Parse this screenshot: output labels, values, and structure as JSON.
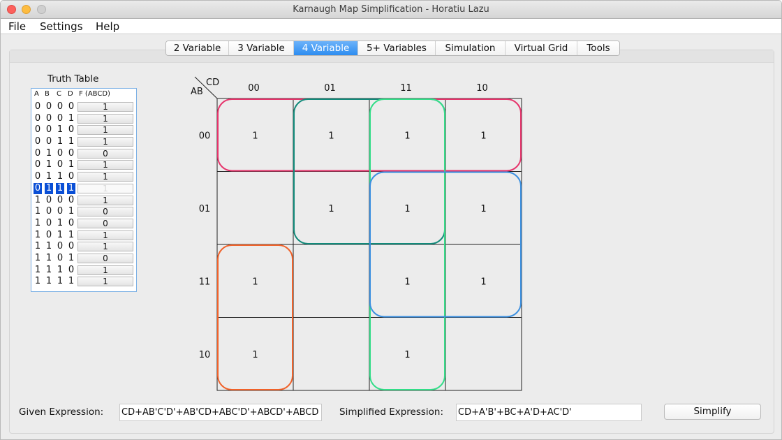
{
  "window": {
    "title": "Karnaugh Map Simplification - Horatiu Lazu"
  },
  "menu": [
    "File",
    "Settings",
    "Help"
  ],
  "tabs": [
    "2 Variable",
    "3 Variable",
    "4 Variable",
    "5+ Variables",
    "Simulation",
    "Virtual Grid",
    "Tools"
  ],
  "active_tab": "4 Variable",
  "truth_table": {
    "title": "Truth Table",
    "headers": [
      "A",
      "B",
      "C",
      "D",
      "F (ABCD)"
    ],
    "rows": [
      {
        "bits": [
          "0",
          "0",
          "0",
          "0"
        ],
        "f": "1"
      },
      {
        "bits": [
          "0",
          "0",
          "0",
          "1"
        ],
        "f": "1"
      },
      {
        "bits": [
          "0",
          "0",
          "1",
          "0"
        ],
        "f": "1"
      },
      {
        "bits": [
          "0",
          "0",
          "1",
          "1"
        ],
        "f": "1"
      },
      {
        "bits": [
          "0",
          "1",
          "0",
          "0"
        ],
        "f": "0"
      },
      {
        "bits": [
          "0",
          "1",
          "0",
          "1"
        ],
        "f": "1"
      },
      {
        "bits": [
          "0",
          "1",
          "1",
          "0"
        ],
        "f": "1"
      },
      {
        "bits": [
          "0",
          "1",
          "1",
          "1"
        ],
        "f": "1"
      },
      {
        "bits": [
          "1",
          "0",
          "0",
          "0"
        ],
        "f": "1"
      },
      {
        "bits": [
          "1",
          "0",
          "0",
          "1"
        ],
        "f": "0"
      },
      {
        "bits": [
          "1",
          "0",
          "1",
          "0"
        ],
        "f": "0"
      },
      {
        "bits": [
          "1",
          "0",
          "1",
          "1"
        ],
        "f": "1"
      },
      {
        "bits": [
          "1",
          "1",
          "0",
          "0"
        ],
        "f": "1"
      },
      {
        "bits": [
          "1",
          "1",
          "0",
          "1"
        ],
        "f": "0"
      },
      {
        "bits": [
          "1",
          "1",
          "1",
          "0"
        ],
        "f": "1"
      },
      {
        "bits": [
          "1",
          "1",
          "1",
          "1"
        ],
        "f": "1"
      }
    ],
    "selected_row": 7
  },
  "kmap": {
    "corner_top": "CD",
    "corner_left": "AB",
    "col_labels": [
      "00",
      "01",
      "11",
      "10"
    ],
    "row_labels": [
      "00",
      "01",
      "11",
      "10"
    ],
    "cells": [
      [
        "1",
        "1",
        "1",
        "1"
      ],
      [
        "",
        "1",
        "1",
        "1"
      ],
      [
        "1",
        "",
        "1",
        "1"
      ],
      [
        "1",
        "",
        "1",
        ""
      ]
    ],
    "groups": [
      {
        "color": "#e6336b",
        "rows": [
          0,
          0
        ],
        "cols": [
          0,
          3
        ]
      },
      {
        "color": "#128a7a",
        "rows": [
          0,
          1
        ],
        "cols": [
          1,
          2
        ]
      },
      {
        "color": "#33dd88",
        "rows": [
          0,
          3
        ],
        "cols": [
          2,
          2
        ]
      },
      {
        "color": "#3a8fe0",
        "rows": [
          1,
          2
        ],
        "cols": [
          2,
          3
        ]
      },
      {
        "color": "#f0622a",
        "rows": [
          2,
          3
        ],
        "cols": [
          0,
          0
        ]
      }
    ]
  },
  "bottom": {
    "given_label": "Given Expression:",
    "given_value": "CD+AB'C'D'+AB'CD+ABC'D'+ABCD'+ABCD",
    "simplified_label": "Simplified Expression:",
    "simplified_value": "CD+A'B'+BC+A'D+AC'D'",
    "simplify_button": "Simplify"
  }
}
